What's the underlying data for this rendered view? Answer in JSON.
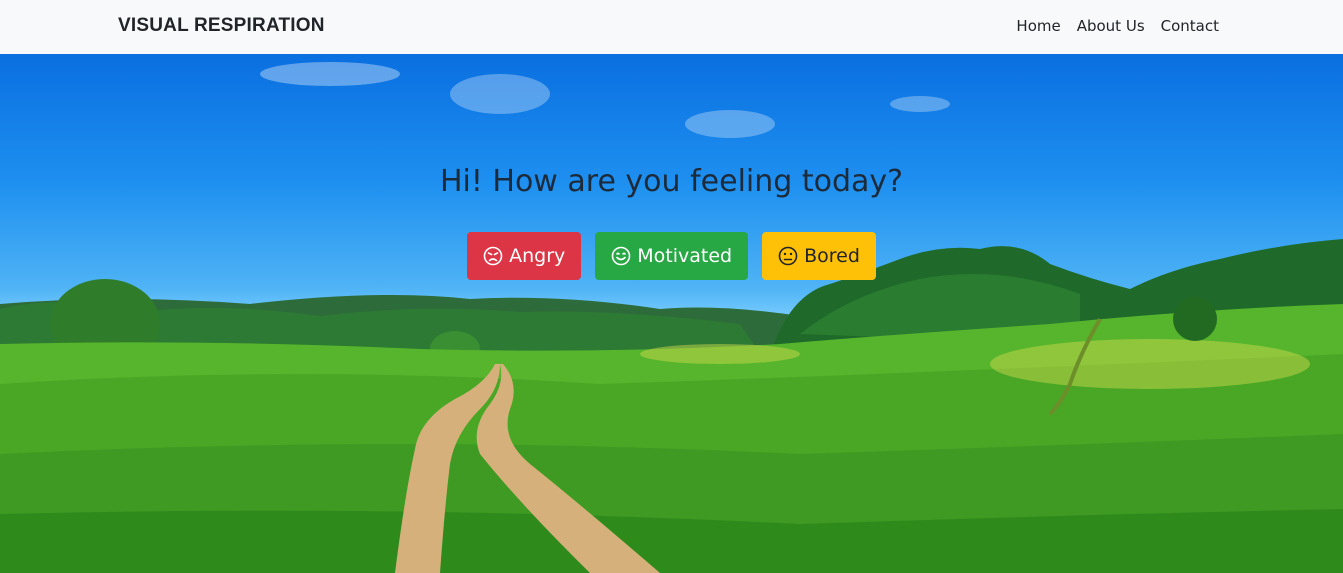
{
  "navbar": {
    "brand": "VISUAL RESPIRATION",
    "links": [
      "Home",
      "About Us",
      "Contact"
    ]
  },
  "hero": {
    "headline": "Hi! How are you feeling today?",
    "buttons": [
      {
        "label": "Angry",
        "icon": "angry-face-icon",
        "color": "#dc3545"
      },
      {
        "label": "Motivated",
        "icon": "smile-face-icon",
        "color": "#28a745"
      },
      {
        "label": "Bored",
        "icon": "neutral-face-icon",
        "color": "#ffc107"
      }
    ]
  },
  "colors": {
    "navbar_bg": "#f8f9fa",
    "text_dark": "#212529"
  }
}
